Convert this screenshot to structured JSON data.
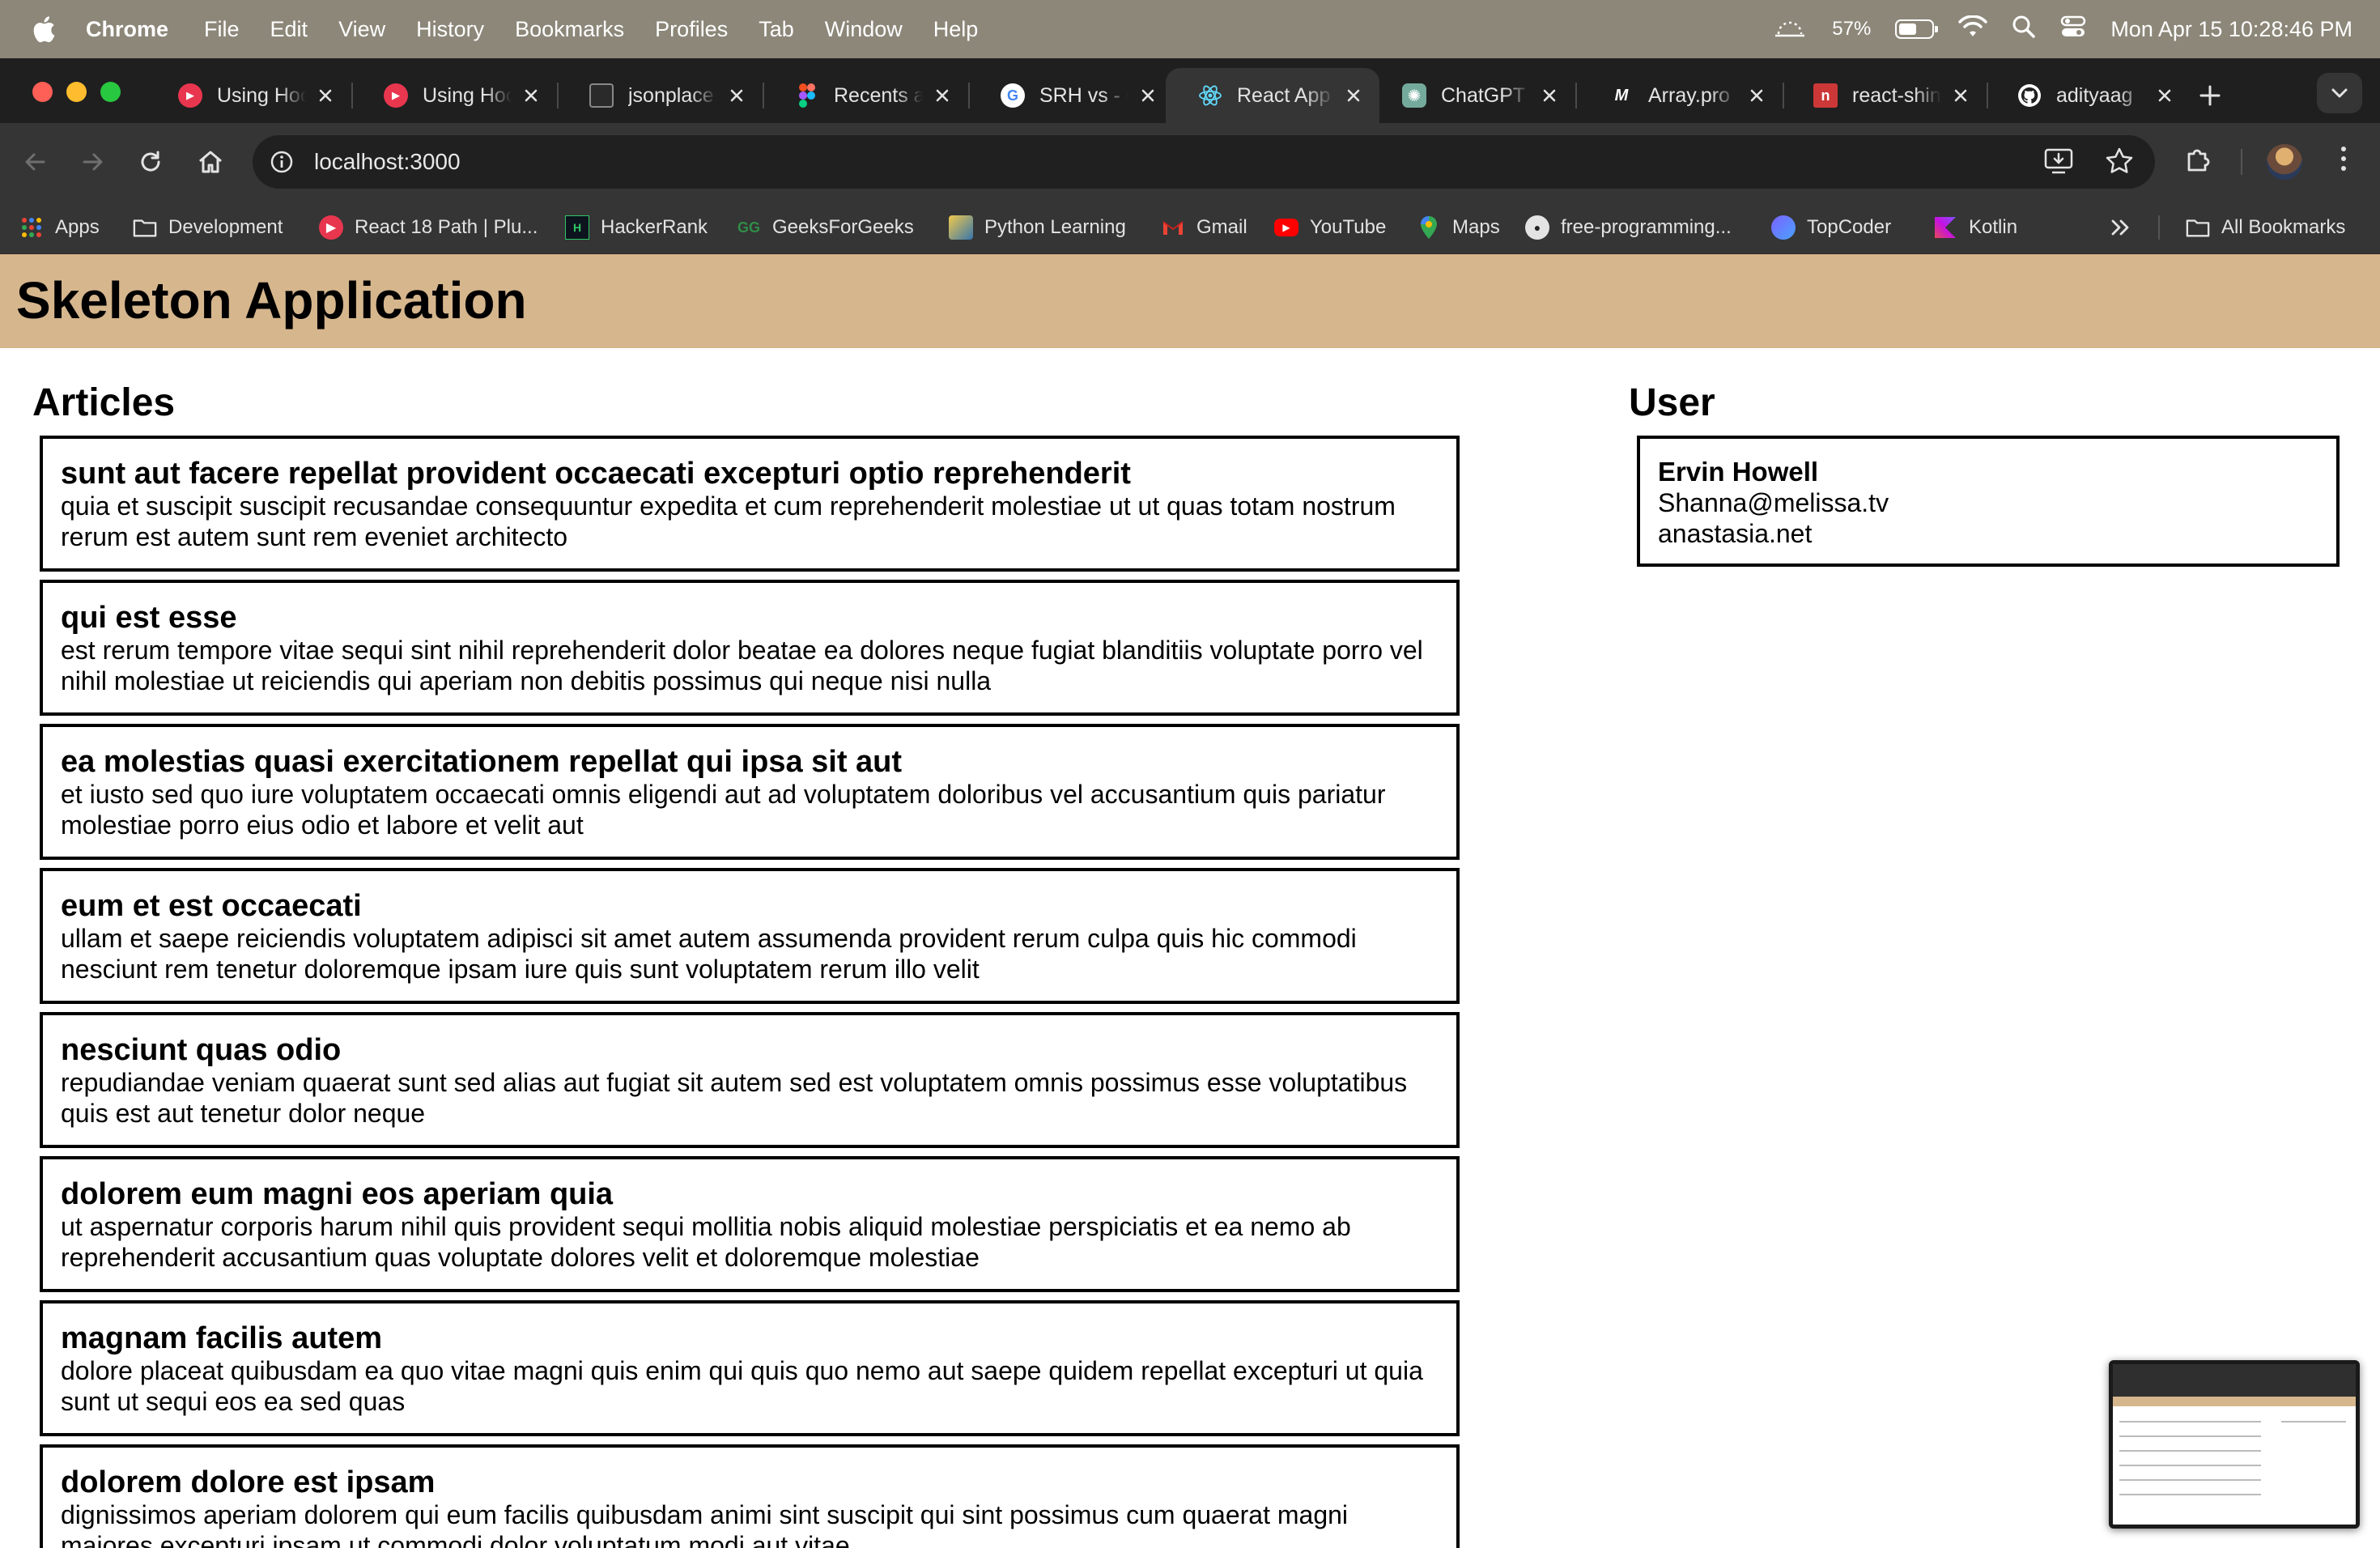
{
  "menubar": {
    "app_name": "Chrome",
    "items": [
      "File",
      "Edit",
      "View",
      "History",
      "Bookmarks",
      "Profiles",
      "Tab",
      "Window",
      "Help"
    ],
    "battery_percent": "57%",
    "battery_level": 0.57,
    "datetime": "Mon Apr 15  10:28:46 PM"
  },
  "tabs": [
    {
      "title": "Using Hoo",
      "icon": "youtube-play-icon",
      "color": "#e8364f"
    },
    {
      "title": "Using Hoo",
      "icon": "youtube-play-icon",
      "color": "#e8364f"
    },
    {
      "title": "jsonplace",
      "icon": "terminal-icon",
      "color": "#2a2a2a"
    },
    {
      "title": "Recents a",
      "icon": "figma-icon",
      "color": "#f24e1e"
    },
    {
      "title": "SRH vs - G",
      "icon": "google-icon",
      "color": "#ffffff"
    },
    {
      "title": "React App",
      "icon": "react-icon",
      "color": "#61dafb"
    },
    {
      "title": "ChatGPT",
      "icon": "chatgpt-icon",
      "color": "#74aa9c"
    },
    {
      "title": "Array.pro",
      "icon": "mdn-icon",
      "color": "#1f1f1f"
    },
    {
      "title": "react-shin",
      "icon": "npm-icon",
      "color": "#cb3837"
    },
    {
      "title": "adityaag",
      "icon": "github-icon",
      "color": "#ffffff"
    }
  ],
  "toolbar": {
    "url": "localhost:3000"
  },
  "bookmarks": [
    {
      "label": "Apps"
    },
    {
      "label": "Development"
    },
    {
      "label": "React 18 Path | Plu..."
    },
    {
      "label": "HackerRank"
    },
    {
      "label": "GeeksForGeeks"
    },
    {
      "label": "Python Learning"
    },
    {
      "label": "Gmail"
    },
    {
      "label": "YouTube"
    },
    {
      "label": "Maps"
    },
    {
      "label": "free-programming..."
    },
    {
      "label": "TopCoder"
    },
    {
      "label": "Kotlin"
    }
  ],
  "all_bookmarks_label": "All Bookmarks",
  "app": {
    "title": "Skeleton Application",
    "header_color": "#d6b68d",
    "articles_heading": "Articles",
    "user_heading": "User",
    "articles": [
      {
        "title": "sunt aut facere repellat provident occaecati excepturi optio reprehenderit",
        "body": "quia et suscipit suscipit recusandae consequuntur expedita et cum reprehenderit molestiae ut ut quas totam nostrum rerum est autem sunt rem eveniet architecto"
      },
      {
        "title": "qui est esse",
        "body": "est rerum tempore vitae sequi sint nihil reprehenderit dolor beatae ea dolores neque fugiat blanditiis voluptate porro vel nihil molestiae ut reiciendis qui aperiam non debitis possimus qui neque nisi nulla"
      },
      {
        "title": "ea molestias quasi exercitationem repellat qui ipsa sit aut",
        "body": "et iusto sed quo iure voluptatem occaecati omnis eligendi aut ad voluptatem doloribus vel accusantium quis pariatur molestiae porro eius odio et labore et velit aut"
      },
      {
        "title": "eum et est occaecati",
        "body": "ullam et saepe reiciendis voluptatem adipisci sit amet autem assumenda provident rerum culpa quis hic commodi nesciunt rem tenetur doloremque ipsam iure quis sunt voluptatem rerum illo velit"
      },
      {
        "title": "nesciunt quas odio",
        "body": "repudiandae veniam quaerat sunt sed alias aut fugiat sit autem sed est voluptatem omnis possimus esse voluptatibus quis est aut tenetur dolor neque"
      },
      {
        "title": "dolorem eum magni eos aperiam quia",
        "body": "ut aspernatur corporis harum nihil quis provident sequi mollitia nobis aliquid molestiae perspiciatis et ea nemo ab reprehenderit accusantium quas voluptate dolores velit et doloremque molestiae"
      },
      {
        "title": "magnam facilis autem",
        "body": "dolore placeat quibusdam ea quo vitae magni quis enim qui quis quo nemo aut saepe quidem repellat excepturi ut quia sunt ut sequi eos ea sed quas"
      },
      {
        "title": "dolorem dolore est ipsam",
        "body": "dignissimos aperiam dolorem qui eum facilis quibusdam animi sint suscipit qui sint possimus cum quaerat magni maiores excepturi ipsam ut commodi dolor voluptatum modi aut vitae"
      }
    ],
    "user": {
      "name": "Ervin Howell",
      "email": "Shanna@melissa.tv",
      "website": "anastasia.net"
    }
  }
}
